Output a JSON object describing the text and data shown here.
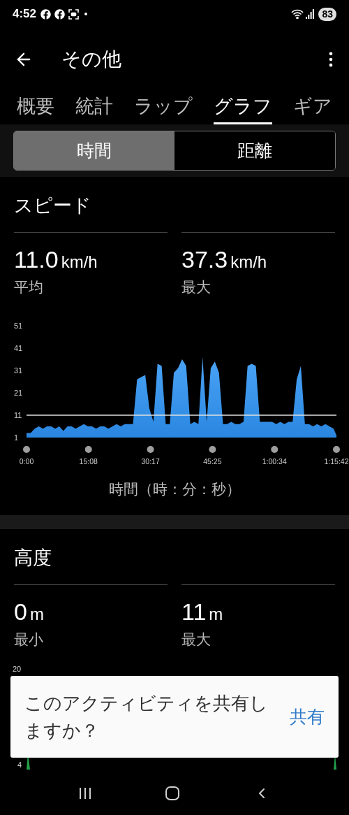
{
  "status_bar": {
    "time": "4:52",
    "battery": "83"
  },
  "app_bar": {
    "title": "その他"
  },
  "tabs": [
    {
      "label": "概要",
      "selected": false
    },
    {
      "label": "統計",
      "selected": false
    },
    {
      "label": "ラップ",
      "selected": false
    },
    {
      "label": "グラフ",
      "selected": true
    },
    {
      "label": "ギア",
      "selected": false
    }
  ],
  "segments": [
    {
      "label": "時間",
      "selected": true
    },
    {
      "label": "距離",
      "selected": false
    }
  ],
  "speed": {
    "title": "スピード",
    "stats": [
      {
        "value": "11.0",
        "unit": "km/h",
        "label": "平均"
      },
      {
        "value": "37.3",
        "unit": "km/h",
        "label": "最大"
      }
    ],
    "chart_data": {
      "type": "area",
      "xlabel": "時間（時：分：秒）",
      "xlim": [
        0,
        75.7
      ],
      "ylim": [
        1,
        51
      ],
      "yticks": [
        1,
        11,
        21,
        31,
        41,
        51
      ],
      "xticks": [
        {
          "value": 0,
          "label": "0:00"
        },
        {
          "value": 15.13,
          "label": "15:08"
        },
        {
          "value": 30.28,
          "label": "30:17"
        },
        {
          "value": 45.42,
          "label": "45:25"
        },
        {
          "value": 60.57,
          "label": "1:00:34"
        },
        {
          "value": 75.7,
          "label": "1:15:42"
        }
      ],
      "x": [
        0,
        1,
        2,
        3,
        4,
        5,
        6,
        7,
        8,
        9,
        10,
        11,
        12,
        13,
        14,
        15,
        16,
        17,
        18,
        19,
        20,
        21,
        22,
        23,
        24,
        25,
        26,
        27,
        28,
        29,
        30,
        31,
        32,
        33,
        34,
        35,
        36,
        37,
        38,
        39,
        40,
        41,
        42,
        43,
        44,
        45,
        46,
        47,
        48,
        49,
        50,
        51,
        52,
        53,
        54,
        55,
        56,
        57,
        58,
        59,
        60,
        61,
        62,
        63,
        64,
        65,
        66,
        67,
        68,
        69,
        70,
        71,
        72,
        73,
        74,
        75,
        75.7
      ],
      "series": [
        {
          "color": "#2a86e0",
          "values": [
            3,
            3,
            5,
            6,
            5,
            6,
            6,
            5,
            6,
            4,
            6,
            6,
            5,
            6,
            7,
            6,
            6,
            5,
            6,
            6,
            5,
            6,
            7,
            6,
            7,
            7,
            7,
            27,
            28,
            29,
            14,
            8,
            34,
            33,
            7,
            7,
            30,
            32,
            36,
            33,
            7,
            8,
            7,
            37,
            8,
            32,
            35,
            30,
            7,
            7,
            8,
            7,
            7,
            8,
            33,
            34,
            33,
            8,
            8,
            8,
            8,
            7,
            8,
            7,
            8,
            8,
            27,
            33,
            7,
            7,
            6,
            7,
            6,
            7,
            6,
            5,
            2
          ]
        }
      ],
      "ref_lines": [
        {
          "axis": "y",
          "value": 11
        }
      ]
    }
  },
  "altitude": {
    "title": "高度",
    "stats": [
      {
        "value": "0",
        "unit": "m",
        "label": "最小"
      },
      {
        "value": "11",
        "unit": "m",
        "label": "最大"
      }
    ],
    "axis_labels": [
      "20",
      "4"
    ]
  },
  "snackbar": {
    "message": "このアクティビティを共有しますか？",
    "action": "共有"
  }
}
